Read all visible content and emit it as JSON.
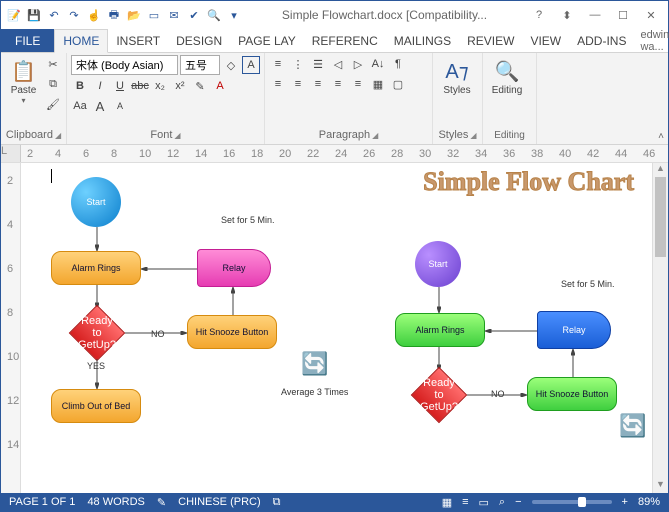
{
  "title": "Simple Flowchart.docx [Compatibility...",
  "qat_icons": [
    "word-icon",
    "save-icon",
    "undo-icon",
    "redo-icon",
    "touch-icon",
    "print-icon",
    "open-icon",
    "new-icon",
    "email-icon",
    "spell-icon",
    "find-icon",
    "dropdown-icon"
  ],
  "win": {
    "help": "?",
    "fullup": "⬍",
    "min": "—",
    "max": "☐",
    "close": "✕"
  },
  "tabs": {
    "file": "FILE",
    "list": [
      "HOME",
      "INSERT",
      "DESIGN",
      "PAGE LAY",
      "REFERENC",
      "MAILINGS",
      "REVIEW",
      "VIEW",
      "ADD-INS"
    ],
    "active": 0
  },
  "user": {
    "name": "edwin wa...",
    "drop": "▾"
  },
  "ribbon": {
    "clipboard": {
      "label": "Clipboard",
      "paste": "Paste"
    },
    "font": {
      "label": "Font",
      "name": "宋体 (Body Asian)",
      "size": "五号",
      "bold": "B",
      "italic": "I",
      "under": "U",
      "strike": "abc",
      "sub": "x₂",
      "sup": "x²",
      "clear": "◇",
      "case": "Aa",
      "grow": "A",
      "shrink": "A",
      "hilite": "✎",
      "color": "A",
      "border": "A"
    },
    "para": {
      "label": "Paragraph",
      "bullets": "≡",
      "num": "⋮",
      "multi": "☰",
      "dec": "◁",
      "inc": "▷",
      "sort": "A↓",
      "show": "¶",
      "l": "≡",
      "c": "≡",
      "r": "≡",
      "j": "≡",
      "ls": "≡",
      "shade": "▦",
      "bd": "▢"
    },
    "styles": {
      "label": "Styles",
      "btn": "Styles"
    },
    "editing": {
      "label": "Editing",
      "btn": "Editing"
    }
  },
  "ruler_h": [
    2,
    4,
    6,
    8,
    10,
    12,
    14,
    16,
    18,
    20,
    22,
    24,
    26,
    28,
    30,
    32,
    34,
    36,
    38,
    40,
    42,
    44,
    46
  ],
  "ruler_v": [
    2,
    4,
    6,
    8,
    10,
    12,
    14
  ],
  "doc": {
    "title": "Simple Flow Chart",
    "left": {
      "start": "Start",
      "alarm": "Alarm Rings",
      "relay": "Relay",
      "snooze": "Hit Snooze Button",
      "ready": "Ready to GetUp?",
      "no": "NO",
      "yes": "YES",
      "climb": "Climb Out of Bed",
      "set": "Set for 5 Min.",
      "avg": "Average 3 Times"
    },
    "right": {
      "start": "Start",
      "alarm": "Alarm Rings",
      "relay": "Relay",
      "ready": "Ready to GetUp?",
      "no": "NO",
      "snooze": "Hit Snooze Button",
      "set": "Set for 5 Min."
    }
  },
  "status": {
    "page": "PAGE 1 OF 1",
    "words": "48 WORDS",
    "proof": "✎",
    "lang": "CHINESE (PRC)",
    "macro": "⧉",
    "views": [
      "▦",
      "≡",
      "▭",
      "⌕"
    ],
    "zoom_minus": "−",
    "zoom_plus": "+",
    "zoom": "89%"
  }
}
